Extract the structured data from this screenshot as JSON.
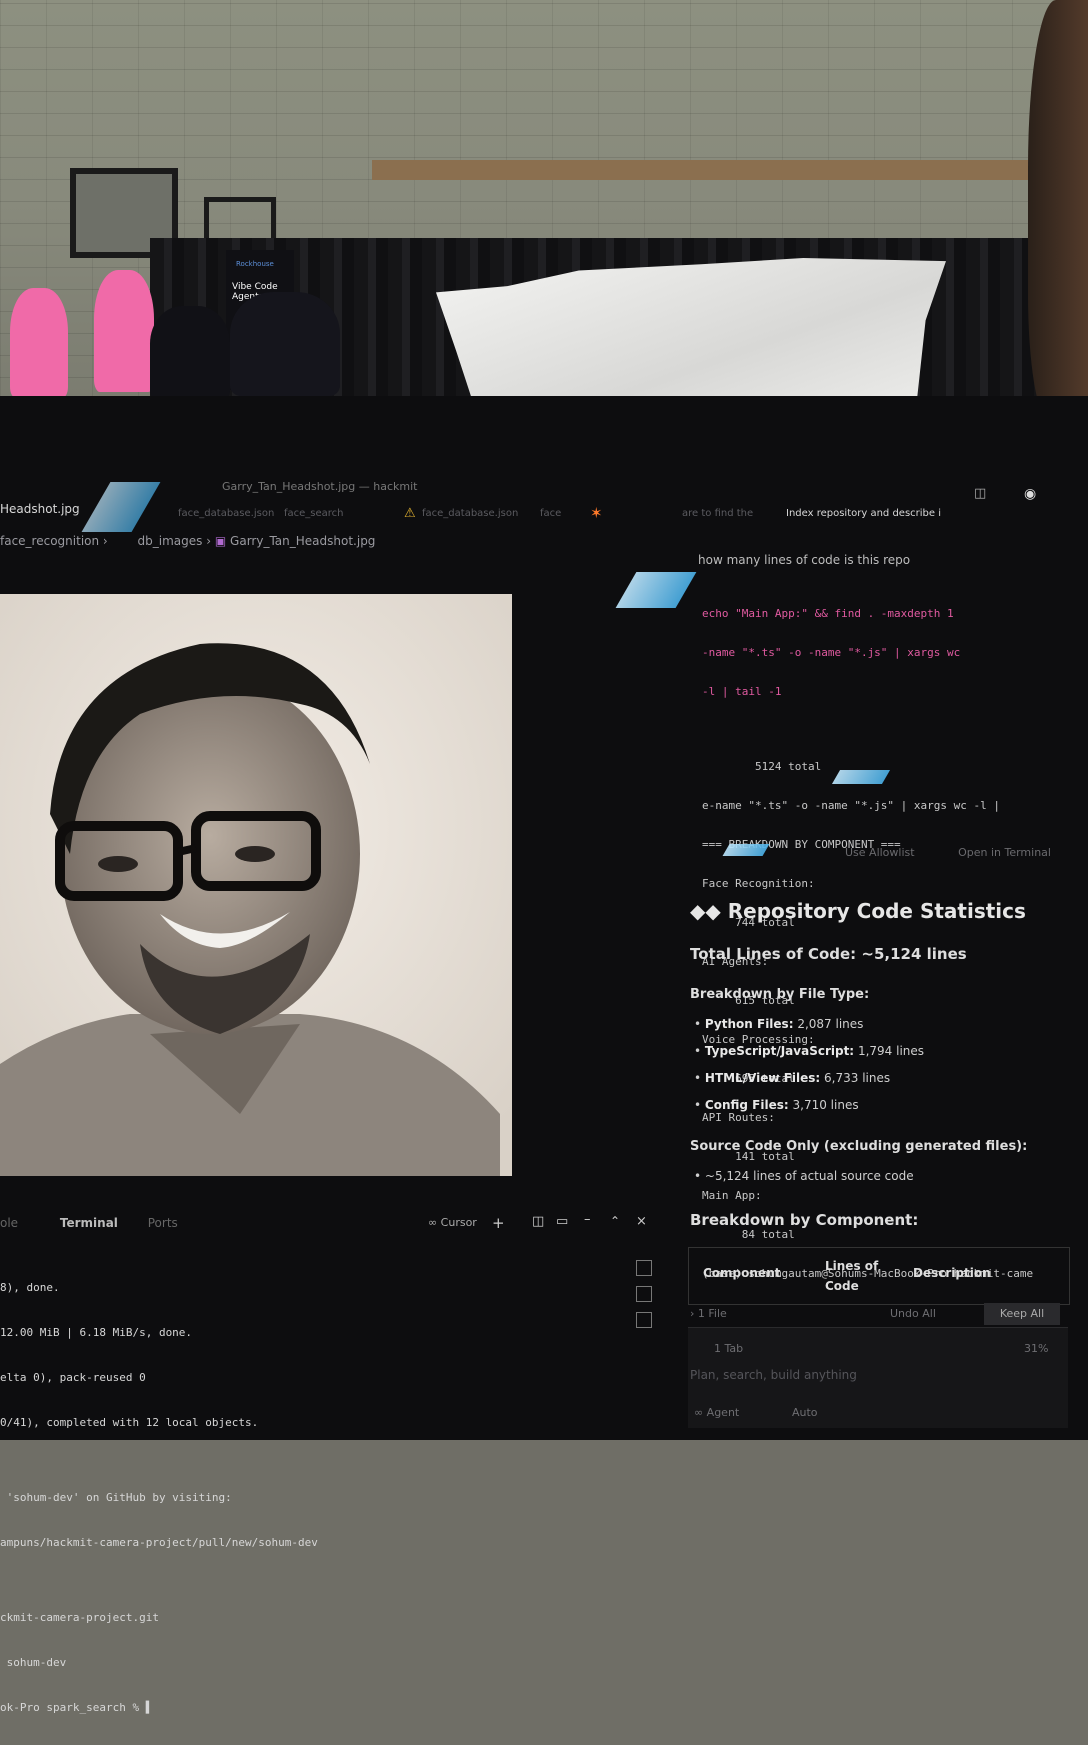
{
  "scene": {
    "banner_brand": "Rockhouse",
    "banner_text": "Vibe Code Agents with"
  },
  "window": {
    "title": "Garry_Tan_Headshot.jpg — hackmit"
  },
  "tabs": {
    "active": "Headshot.jpg",
    "t2": "face_database.json",
    "t3": "face_search",
    "t4": "face_database.json",
    "t5": "face",
    "chat_tab1": "are to find the",
    "chat_tab2": "Index repository and describe i"
  },
  "breadcrumb": {
    "part1": "face_recognition",
    "part2": "db_images",
    "part3": "Garry_Tan_Headshot.jpg"
  },
  "agent": {
    "prompt": "how many lines of code is this repo",
    "cmd_lines": [
      "echo \"Main App:\" && find . -maxdepth 1",
      "-name \"*.ts\" -o -name \"*.js\" | xargs wc",
      "-l | tail -1"
    ],
    "out_lines": [
      "        5124 total",
      "e-name \"*.ts\" -o -name \"*.js\" | xargs wc -l |",
      "=== BREAKDOWN BY COMPONENT ===",
      "Face Recognition:",
      "     744 total",
      "AI Agents:",
      "     615 total",
      "Voice Processing:",
      "     695 total",
      "API Routes:",
      "     141 total",
      "Main App:",
      "      84 total",
      "(base) sohumgautam@Sohums-MacBook-Pro hackmit-came"
    ],
    "action_allowlist": "Use Allowlist",
    "action_terminal": "Open in Terminal",
    "stats_title": "Repository Code Statistics",
    "total_loc": "Total Lines of Code: ~5,124 lines",
    "by_file_type": "Breakdown by File Type:",
    "file_types": [
      {
        "label": "Python Files:",
        "value": "2,087 lines"
      },
      {
        "label": "TypeScript/JavaScript:",
        "value": "1,794 lines"
      },
      {
        "label": "HTML/View Files:",
        "value": "6,733 lines"
      },
      {
        "label": "Config Files:",
        "value": "3,710 lines"
      }
    ],
    "source_only": "Source Code Only (excluding generated files):",
    "source_bullet": "~5,124 lines of actual source code",
    "by_component": "Breakdown by Component:",
    "table_headers": [
      "Component",
      "Lines of Code",
      "Description"
    ],
    "files_changed": "1 File",
    "undo_all": "Undo All",
    "keep_all": "Keep All",
    "todo": "1 Tab",
    "input_placeholder": "Plan, search, build anything",
    "mode": "Agent",
    "mode_opt": "Auto",
    "pct": "31%"
  },
  "terminal": {
    "tab_terminal": "Terminal",
    "tab_ports": "Ports",
    "tab_left": "ole",
    "shell_label": "Cursor",
    "lines": [
      "8), done.",
      "12.00 MiB | 6.18 MiB/s, done.",
      "elta 0), pack-reused 0",
      "0/41), completed with 12 local objects.",
      "",
      " 'sohum-dev' on GitHub by visiting:",
      "ampuns/hackmit-camera-project/pull/new/sohum-dev",
      "",
      "ckmit-camera-project.git",
      " sohum-dev",
      "ok-Pro spark_search % ▌"
    ]
  },
  "colors": {
    "command": "#e05aa0",
    "hoodie": "#f06aa8"
  }
}
